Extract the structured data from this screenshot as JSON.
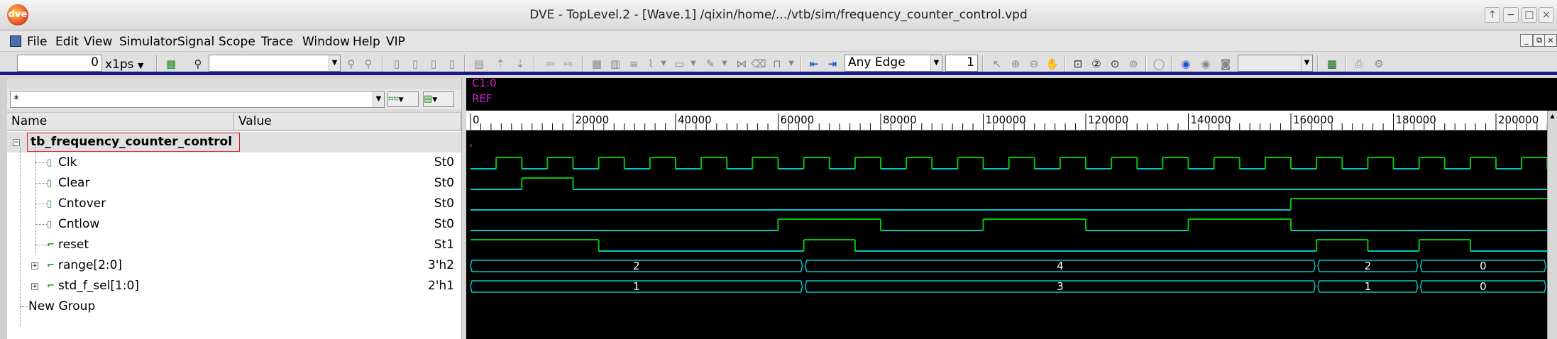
{
  "window": {
    "title": "DVE - TopLevel.2 - [Wave.1]  /qixin/home/.../vtb/sim/frequency_counter_control.vpd",
    "logo_text": "dve",
    "controls": [
      "↑",
      "−",
      "□",
      "×"
    ]
  },
  "menu": {
    "items": [
      {
        "label": "File"
      },
      {
        "label": "Edit"
      },
      {
        "label": "View"
      },
      {
        "label": "Simulator"
      },
      {
        "label": "Signal"
      },
      {
        "label": "Scope"
      },
      {
        "label": "Trace"
      },
      {
        "label": "Window"
      },
      {
        "label": "Help"
      },
      {
        "label": "VIP"
      }
    ],
    "mdi_controls": [
      "_",
      "⧉",
      "×"
    ]
  },
  "toolbar": {
    "time_value": "0",
    "time_unit": "x1ps",
    "search_value": "",
    "edge_select": "Any Edge",
    "edge_count": "1"
  },
  "signals_pane": {
    "filter_value": "*",
    "columns": [
      "Name",
      "Value"
    ],
    "scope": "tb_frequency_counter_control",
    "signals": [
      {
        "name": "Clk",
        "value": "St0",
        "icon": "bit-icon"
      },
      {
        "name": "Clear",
        "value": "St0",
        "icon": "bit-icon"
      },
      {
        "name": "Cntover",
        "value": "St0",
        "icon": "bit-icon"
      },
      {
        "name": "Cntlow",
        "value": "St0",
        "icon": "bit-icon"
      },
      {
        "name": "reset",
        "value": "St1",
        "icon": "wire-icon"
      },
      {
        "name": "range[2:0]",
        "value": "3'h2",
        "icon": "bus-icon",
        "expandable": true
      },
      {
        "name": "std_f_sel[1:0]",
        "value": "2'h1",
        "icon": "bus-icon",
        "expandable": true
      }
    ],
    "group": "New Group"
  },
  "wave_pane": {
    "cursor_label": "C1:0",
    "ref_label": "REF",
    "ruler_labels": [
      "0",
      "20000",
      "40000",
      "60000",
      "80000",
      "100000",
      "120000",
      "140000",
      "160000",
      "180000",
      "200000"
    ],
    "ruler_values": [
      0,
      20000,
      40000,
      60000,
      80000,
      100000,
      120000,
      140000,
      160000,
      180000,
      200000
    ],
    "time_range": [
      0,
      210000
    ],
    "clk_period": 10000,
    "colors": {
      "bus": "#00c8c8",
      "high": "#00c800",
      "cursor": "#d020d0",
      "background": "#000000"
    },
    "waves": {
      "Clk": {
        "type": "clock",
        "first_rise": 5000,
        "period": 10000
      },
      "Clear": {
        "type": "bit",
        "init": 0,
        "edges": [
          10000,
          20000
        ]
      },
      "Cntover": {
        "type": "bit",
        "init": 0,
        "edges": [
          160000
        ]
      },
      "Cntlow": {
        "type": "bit",
        "init": 0,
        "edges": [
          60000,
          80000,
          100000,
          120000,
          140000,
          160000
        ]
      },
      "reset": {
        "type": "bit",
        "init": 1,
        "edges": [
          25000,
          65000,
          75000,
          165000,
          175000,
          185000,
          195000
        ]
      },
      "range": {
        "type": "bus",
        "segments": [
          {
            "start": 0,
            "end": 65000,
            "label": "2"
          },
          {
            "start": 65000,
            "end": 165000,
            "label": "4"
          },
          {
            "start": 165000,
            "end": 185000,
            "label": "2"
          },
          {
            "start": 185000,
            "end": 210000,
            "label": "0"
          }
        ]
      },
      "std_f_sel": {
        "type": "bus",
        "segments": [
          {
            "start": 0,
            "end": 65000,
            "label": "1"
          },
          {
            "start": 65000,
            "end": 165000,
            "label": "3"
          },
          {
            "start": 165000,
            "end": 185000,
            "label": "1"
          },
          {
            "start": 185000,
            "end": 210000,
            "label": "0"
          }
        ]
      }
    }
  }
}
